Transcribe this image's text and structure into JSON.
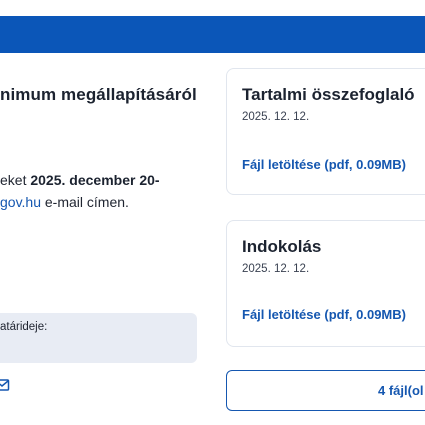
{
  "header": {
    "brand_color": "#0b56b8"
  },
  "main": {
    "heading": "nimum megállapításáról",
    "paragraph_line1_prefix": "eket ",
    "paragraph_line1_bold": "2025. december 20-",
    "paragraph_line2_link": "gov.hu",
    "paragraph_line2_suffix": " e-mail címen.",
    "deadline_label": "atárideje:",
    "mail_icon": "mail-icon"
  },
  "documents": [
    {
      "title": "Tartalmi összefoglaló",
      "date": "2025. 12. 12.",
      "download_label": "Fájl letöltése (pdf, 0.09MB)"
    },
    {
      "title": "Indokolás",
      "date": "2025. 12. 12.",
      "download_label": "Fájl letöltése (pdf, 0.09MB)"
    }
  ],
  "files_button": {
    "label": "4 fájl(ol"
  },
  "colors": {
    "link": "#1557b0",
    "panel_bg": "#e8ecf4",
    "text": "#1c2330"
  }
}
